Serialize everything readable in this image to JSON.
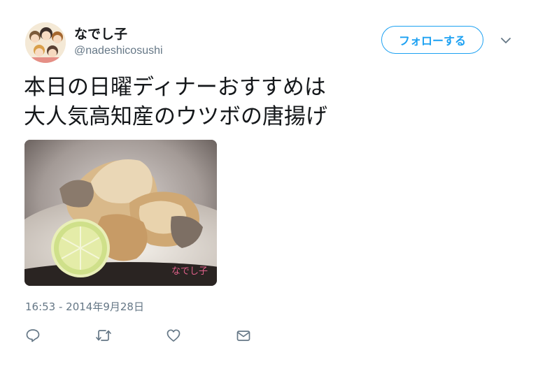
{
  "author": {
    "display_name": "なでし子",
    "handle": "@nadeshicosushi"
  },
  "follow_button_label": "フォローする",
  "tweet": {
    "lines": [
      "本日の日曜ディナーおすすめは",
      "大人気高知産のウツボの唐揚げ"
    ],
    "timestamp": "16:53 - 2014年9月28日"
  },
  "media": {
    "watermark": "なでし子",
    "alt": "ウツボの唐揚げ"
  },
  "actions": [
    {
      "name": "reply",
      "icon": "speech-bubble-icon"
    },
    {
      "name": "retweet",
      "icon": "retweet-icon"
    },
    {
      "name": "like",
      "icon": "heart-icon"
    },
    {
      "name": "direct-message",
      "icon": "envelope-icon"
    }
  ],
  "colors": {
    "accent": "#1da1f2",
    "text": "#14171a",
    "secondary_text": "#657786",
    "icon": "#657786"
  }
}
